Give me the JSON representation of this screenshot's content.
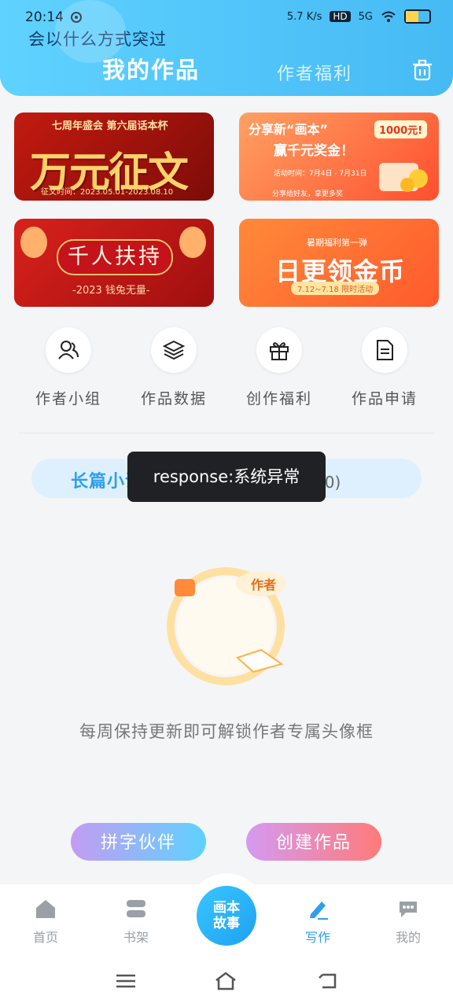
{
  "status": {
    "time": "20:14",
    "net_speed": "5.7 K/s",
    "hd": "HD",
    "signal": "5G",
    "battery": "54"
  },
  "header": {
    "notice": "会以什么方式突过",
    "tab_active": "我的作品",
    "tab_other": "作者福利"
  },
  "banners": [
    {
      "top": "七周年盛会  第六届话本杯",
      "main": "万元征文",
      "date": "征文时间：2023.05.01-2023.08.10"
    },
    {
      "title": "分享新“画本”",
      "subtitle": "赢千元奖金！",
      "badge": "1000元!",
      "date": "活动时间：7月4日 - 7月31日",
      "foot": "分享给好友，拿更多奖"
    },
    {
      "main": "千人扶持",
      "sub": "-2023 钱兔无量-"
    },
    {
      "top": "暑期福利第一弹",
      "main": "日更领金币",
      "tag": "7.12~7.18 限时活动"
    }
  ],
  "menu": [
    {
      "label": "作者小组",
      "icon": "group-icon"
    },
    {
      "label": "作品数据",
      "icon": "layers-icon"
    },
    {
      "label": "创作福利",
      "icon": "gift-icon"
    },
    {
      "label": "作品申请",
      "icon": "document-icon"
    }
  ],
  "tabs": {
    "long": "长篇小说(0)",
    "short": "故事(0)"
  },
  "toast": "response:系统异常",
  "empty": {
    "badge": "作者",
    "text": "每周保持更新即可解锁作者专属头像框"
  },
  "buttons": {
    "partner": "拼字伙伴",
    "create": "创建作品"
  },
  "nav": {
    "home": "首页",
    "shelf": "书架",
    "center": "画本故事",
    "write": "写作",
    "mine": "我的"
  }
}
